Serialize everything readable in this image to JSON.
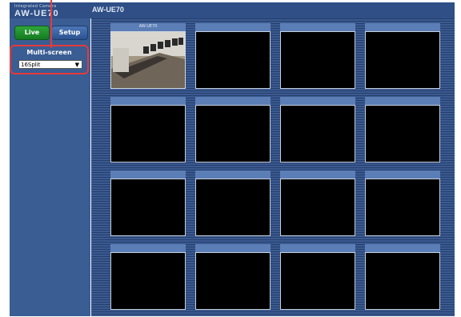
{
  "header": {
    "brand": "Integrated Camera",
    "model": "AW-UE70",
    "title": "AW-UE70"
  },
  "sidebar": {
    "live_label": "Live",
    "setup_label": "Setup",
    "multiscreen_title": "Multi-screen",
    "multiscreen_value": "16Split"
  },
  "tiles": [
    {
      "label": "AW-UE70"
    },
    {
      "label": ""
    },
    {
      "label": ""
    },
    {
      "label": ""
    },
    {
      "label": ""
    },
    {
      "label": ""
    },
    {
      "label": ""
    },
    {
      "label": ""
    },
    {
      "label": ""
    },
    {
      "label": ""
    },
    {
      "label": ""
    },
    {
      "label": ""
    },
    {
      "label": ""
    },
    {
      "label": ""
    },
    {
      "label": ""
    },
    {
      "label": ""
    }
  ],
  "colors": {
    "callout": "#e53a3a",
    "live": "#1f8f2c",
    "setup": "#3a64a6"
  }
}
